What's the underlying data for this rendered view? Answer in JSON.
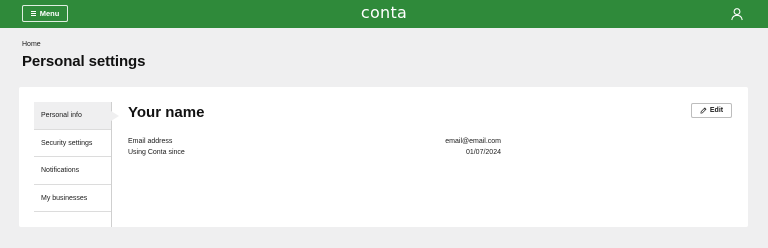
{
  "header": {
    "menu_label": "Menu",
    "logo_text": "conta",
    "brand_color": "#2f8a3a",
    "user_icon": "user-icon"
  },
  "breadcrumb": {
    "label": "Home"
  },
  "page": {
    "title": "Personal settings"
  },
  "sidebar": {
    "items": [
      {
        "label": "Personal info",
        "active": true
      },
      {
        "label": "Security settings",
        "active": false
      },
      {
        "label": "Notifications",
        "active": false
      },
      {
        "label": "My businesses",
        "active": false
      }
    ]
  },
  "content": {
    "title": "Your name",
    "edit_label": "Edit",
    "edit_icon": "pencil-icon",
    "fields": [
      {
        "label": "Email address",
        "value": "email@email.com"
      },
      {
        "label": "Using Conta since",
        "value": "01/07/2024"
      }
    ]
  }
}
